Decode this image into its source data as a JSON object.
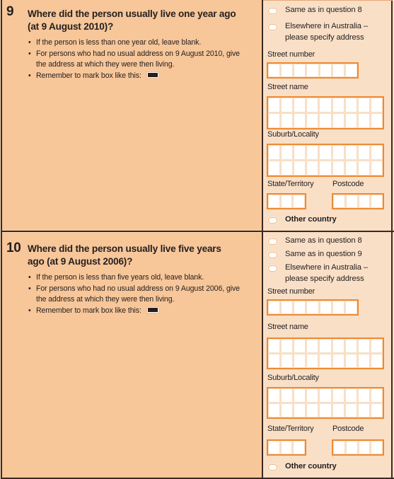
{
  "colors": {
    "left_panel": "#f7c699",
    "right_panel": "#f9dfc6",
    "box_border": "#ee8a33",
    "rule": "#3a2a20"
  },
  "questions": [
    {
      "number": "9",
      "title": "Where did the person usually live one year ago (at 9 August 2010)?",
      "bullets": [
        "If the person is less than one year old, leave blank.",
        "For persons who had no usual address on 9 August 2010, give the address at which they were then living.",
        "Remember to mark box like this:"
      ],
      "options": [
        {
          "label": "Same as in question 8"
        },
        {
          "label": "Elsewhere in Australia – please specify address",
          "line1": "Elsewhere in Australia –",
          "line2": "please specify address"
        }
      ],
      "fields": {
        "street_number": {
          "label": "Street number",
          "cells": 7
        },
        "street_name": {
          "label": "Street name",
          "cells_per_row": 9,
          "rows": 2
        },
        "suburb": {
          "label": "Suburb/Locality",
          "cells_per_row": 9,
          "rows": 2
        },
        "state": {
          "label": "State/Territory",
          "cells": 3
        },
        "postcode": {
          "label": "Postcode",
          "cells": 4
        }
      },
      "other_country": "Other country"
    },
    {
      "number": "10",
      "title": "Where did the person usually live five years ago (at 9 August 2006)?",
      "bullets": [
        "If the person is less than five years old, leave blank.",
        "For persons who had no usual address on 9 August 2006, give the address at which they were then living.",
        "Remember to mark box like this:"
      ],
      "options": [
        {
          "label": "Same as in question 8"
        },
        {
          "label": "Same as in question 9"
        },
        {
          "label": "Elsewhere in Australia – please specify address",
          "line1": "Elsewhere in Australia –",
          "line2": "please specify address"
        }
      ],
      "fields": {
        "street_number": {
          "label": "Street number",
          "cells": 7
        },
        "street_name": {
          "label": "Street name",
          "cells_per_row": 9,
          "rows": 2
        },
        "suburb": {
          "label": "Suburb/Locality",
          "cells_per_row": 9,
          "rows": 2
        },
        "state": {
          "label": "State/Territory",
          "cells": 3
        },
        "postcode": {
          "label": "Postcode",
          "cells": 4
        }
      },
      "other_country": "Other country"
    }
  ]
}
